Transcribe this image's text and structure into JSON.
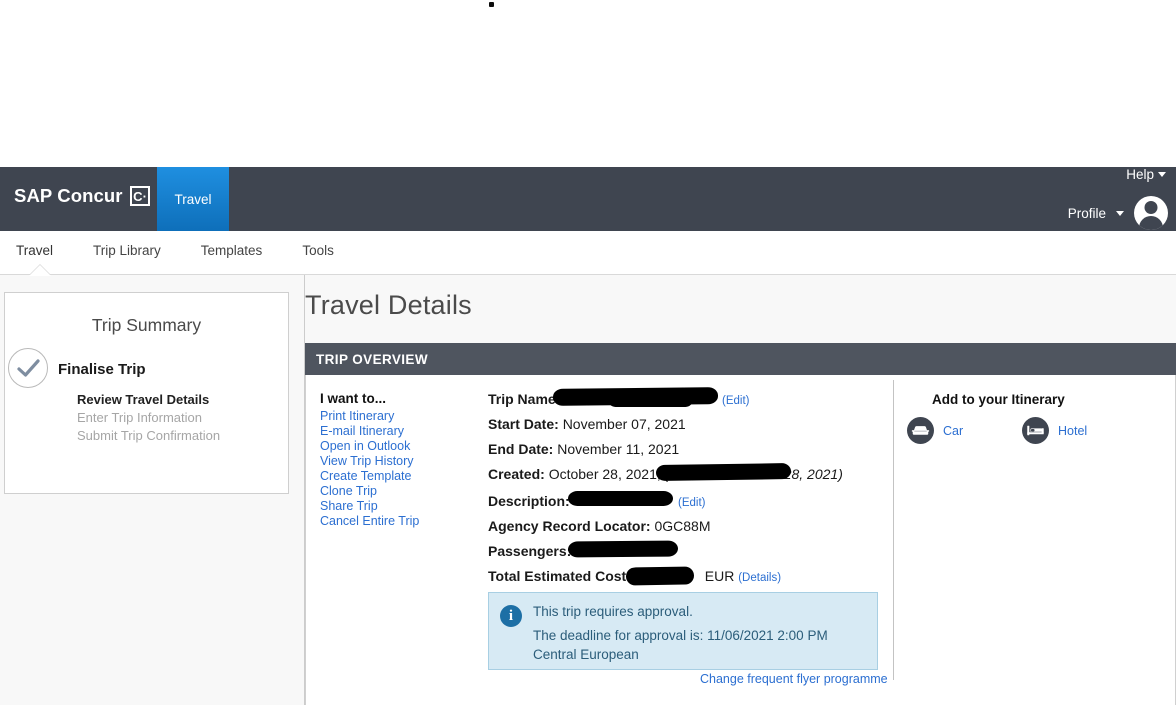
{
  "header": {
    "brand": "SAP Concur",
    "brand_mark": "C·",
    "active_chip": "Travel",
    "help_label": "Help",
    "profile_label": "Profile",
    "bar_color": "#3f4550",
    "chip_color": "#0e6fba"
  },
  "nav": {
    "tabs": [
      {
        "label": "Travel",
        "active": true
      },
      {
        "label": "Trip Library",
        "active": false
      },
      {
        "label": "Templates",
        "active": false
      },
      {
        "label": "Tools",
        "active": false
      }
    ]
  },
  "sidebar": {
    "title": "Trip Summary",
    "step_label": "Finalise Trip",
    "substeps": [
      {
        "label": "Review Travel Details",
        "active": true
      },
      {
        "label": "Enter Trip Information",
        "active": false
      },
      {
        "label": "Submit Trip Confirmation",
        "active": false
      }
    ],
    "check_icon": "check-icon"
  },
  "main": {
    "page_title": "Travel Details",
    "section_header": "TRIP OVERVIEW",
    "section_header_color": "#4f555f"
  },
  "i_want_to": {
    "title": "I want to...",
    "links": [
      "Print Itinerary",
      "E-mail Itinerary",
      "Open in Outlook",
      "View Trip History",
      "Create Template",
      "Clone Trip",
      "Share Trip",
      "Cancel Entire Trip"
    ]
  },
  "trip_details": {
    "trip_name_label": "Trip Name:",
    "trip_name_value": "",
    "trip_name_edit": "(Edit)",
    "start_date_label": "Start Date:",
    "start_date_value": "November 07, 2021",
    "end_date_label": "End Date:",
    "end_date_value": "November 11, 2021",
    "created_label": "Created:",
    "created_value": "October 28, 2021,",
    "created_modified": "(Modified: October 28, 2021)",
    "description_label": "Description:",
    "description_value": "",
    "description_edit": "(Edit)",
    "agency_locator_label": "Agency Record Locator:",
    "agency_locator_value": "0GC88M",
    "passengers_label": "Passengers:",
    "passengers_value": "",
    "total_cost_label": "Total Estimated Cost:",
    "total_cost_currency": "EUR",
    "total_cost_details": "(Details)"
  },
  "approval_notice": {
    "icon": "info-icon",
    "line1": "This trip requires approval.",
    "line2": "The deadline for approval is: 11/06/2021 2:00 PM Central European",
    "background": "#d7eaf4",
    "text_color": "#2b5d7a"
  },
  "change_frequent_flyer": "Change frequent flyer programme",
  "add_itinerary": {
    "title": "Add to your Itinerary",
    "items": [
      {
        "label": "Car",
        "icon": "car-icon"
      },
      {
        "label": "Hotel",
        "icon": "hotel-bed-icon"
      }
    ]
  }
}
